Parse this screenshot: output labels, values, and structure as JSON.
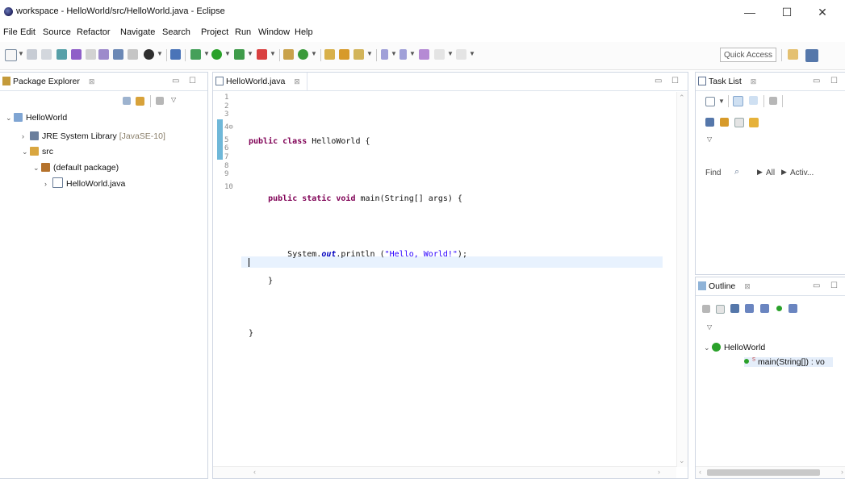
{
  "window": {
    "title": "workspace - HelloWorld/src/HelloWorld.java - Eclipse",
    "minimize": "—",
    "maximize": "☐",
    "close": "✕"
  },
  "menu": [
    "File",
    "Edit",
    "Source",
    "Refactor",
    "Navigate",
    "Search",
    "Project",
    "Run",
    "Window",
    "Help"
  ],
  "toolbar": {
    "quick_access": "Quick Access"
  },
  "package_explorer": {
    "tab": "Package Explorer",
    "tab_close": "⊠",
    "tree": [
      {
        "label": "HelloWorld",
        "twist": "⌄"
      },
      {
        "label": "JRE System Library",
        "suffix": "[JavaSE-10]",
        "twist": "›"
      },
      {
        "label": "src",
        "twist": "⌄"
      },
      {
        "label": "(default package)",
        "twist": "⌄"
      },
      {
        "label": "HelloWorld.java",
        "twist": "›"
      }
    ]
  },
  "editor": {
    "tab": "HelloWorld.java",
    "tab_close": "⊠",
    "line_numbers": [
      "1",
      "2",
      "3",
      "4⊖",
      "5",
      "6",
      "7",
      "8",
      "9",
      "10"
    ],
    "code": {
      "l2_kw": "public class",
      "l2_rest": " HelloWorld {",
      "l4_kw": "public static void",
      "l4_rest": " main(String[] args) {",
      "l6_a": "System.",
      "l6_field": "out",
      "l6_b": ".println (",
      "l6_str": "\"Hello, World!\"",
      "l6_c": ");",
      "l7": "}",
      "l9": "}"
    }
  },
  "task_list": {
    "tab": "Task List",
    "tab_close": "⊠",
    "find": "Find",
    "all": "All",
    "activ": "Activ..."
  },
  "outline": {
    "tab": "Outline",
    "tab_close": "⊠",
    "class": "HelloWorld",
    "method": "main(String[]) : vo",
    "method_mark": "S"
  },
  "colors": {
    "accent": "#6fb8d9",
    "keyword": "#7f0055",
    "string": "#2a00ff",
    "field": "#0000c0"
  }
}
